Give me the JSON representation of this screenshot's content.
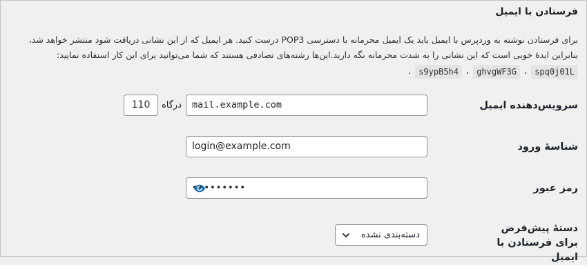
{
  "section": {
    "title": "فرستادن با ایمیل"
  },
  "description": {
    "line1": "برای فرستادن نوشته به وردپرس با ایمیل باید یک ایمیل محرمانه با دسترسی POP3 درست کنید. هر ایمیل که از این نشانی دریافت شود منتشر خواهد شد،",
    "line2": "بنابراین ایدهٔ خوبی است که این نشانی را به شدت محرمانه نگه دارید.این‌ها رشته‌های تصادفی هستند که شما می‌توانید برای این کار استفاده نمایید:",
    "codes": [
      "spq0j01L",
      "ghvgWF3G",
      "s9ypB5h4"
    ],
    "separator": "،",
    "end": "."
  },
  "fields": {
    "mail_server": {
      "label": "سرویس‌دهنده ایمیل",
      "value": "mail.example.com",
      "port_label": "درگاه",
      "port_value": "110"
    },
    "login": {
      "label": "شناسهٔ ورود",
      "value": "login@example.com"
    },
    "password": {
      "label": "رمز عبور",
      "value": "•••••••••",
      "toggle_icon": "eye-icon"
    },
    "category": {
      "label": "دستهٔ پیش‌فرض برای فرستادن با ایمیل",
      "selected": "دسته‌بندی نشده"
    }
  },
  "colors": {
    "background": "#f0f0f1",
    "border": "#8c8f94",
    "accent": "#2271b1"
  }
}
